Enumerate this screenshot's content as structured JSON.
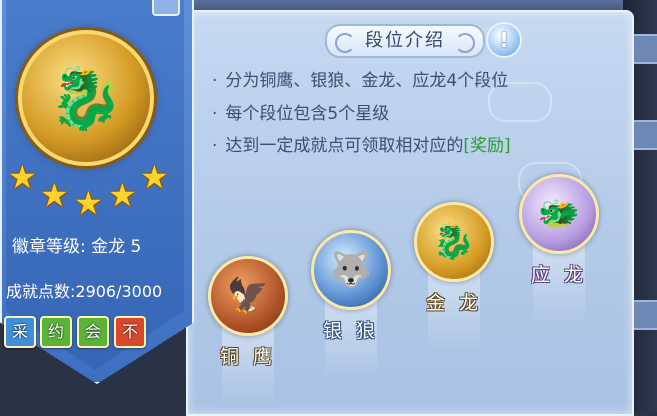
{
  "panel": {
    "title": "段位介绍",
    "info_icon": "info-icon",
    "info_symbol": "!",
    "bullet": "·",
    "lines": [
      {
        "text": "分为铜鹰、银狼、金龙、应龙4个段位"
      },
      {
        "text": "每个段位包含5个星级"
      },
      {
        "text": "达到一定成就点可领取相对应的",
        "reward": "[奖励]"
      }
    ]
  },
  "ranks": [
    {
      "name": "铜 鹰",
      "icon": "eagle-icon",
      "glyph": "🦅"
    },
    {
      "name": "银 狼",
      "icon": "wolf-icon",
      "glyph": "🐺"
    },
    {
      "name": "金 龙",
      "icon": "dragon-icon",
      "glyph": "🐉"
    },
    {
      "name": "应 龙",
      "icon": "winged-dragon-icon",
      "glyph": "🐲"
    }
  ],
  "badge": {
    "icon": "gold-dragon-badge-icon",
    "glyph": "🐉",
    "stars": 5,
    "star_glyph": "★",
    "level_text": "徽章等级: 金龙 5",
    "achievement_text": "成就点数:2906/3000"
  },
  "toolbar": [
    {
      "label": "采",
      "color": "#3f8fd8"
    },
    {
      "label": "约",
      "color": "#5bb33a"
    },
    {
      "label": "会",
      "color": "#5bb33a"
    },
    {
      "label": "不",
      "color": "#d8482e"
    }
  ]
}
